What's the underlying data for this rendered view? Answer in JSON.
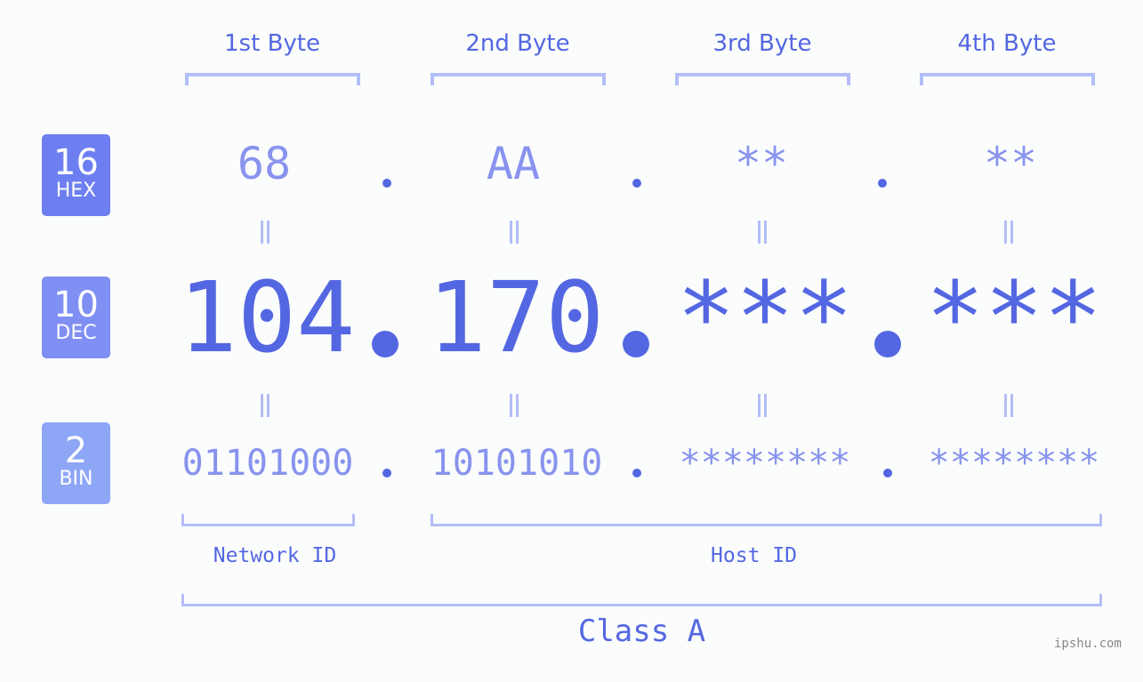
{
  "bases": [
    {
      "num": "16",
      "label": "HEX",
      "color": "#6d7ff0"
    },
    {
      "num": "10",
      "label": "DEC",
      "color": "#7f8ff3"
    },
    {
      "num": "2",
      "label": "BIN",
      "color": "#8ea6f6"
    }
  ],
  "byte_headers": [
    "1st Byte",
    "2nd Byte",
    "3rd Byte",
    "4th Byte"
  ],
  "hex": [
    "68",
    "AA",
    "**",
    "**"
  ],
  "dec": [
    "104",
    "170",
    "***",
    "***"
  ],
  "bin": [
    "01101000",
    "10101010",
    "********",
    "********"
  ],
  "network_id_label": "Network ID",
  "host_id_label": "Host ID",
  "class_label": "Class A",
  "watermark": "ipshu.com",
  "colors": {
    "accent": "#5467e2",
    "light": "#8893ee",
    "bracket": "#b3bdf7"
  }
}
